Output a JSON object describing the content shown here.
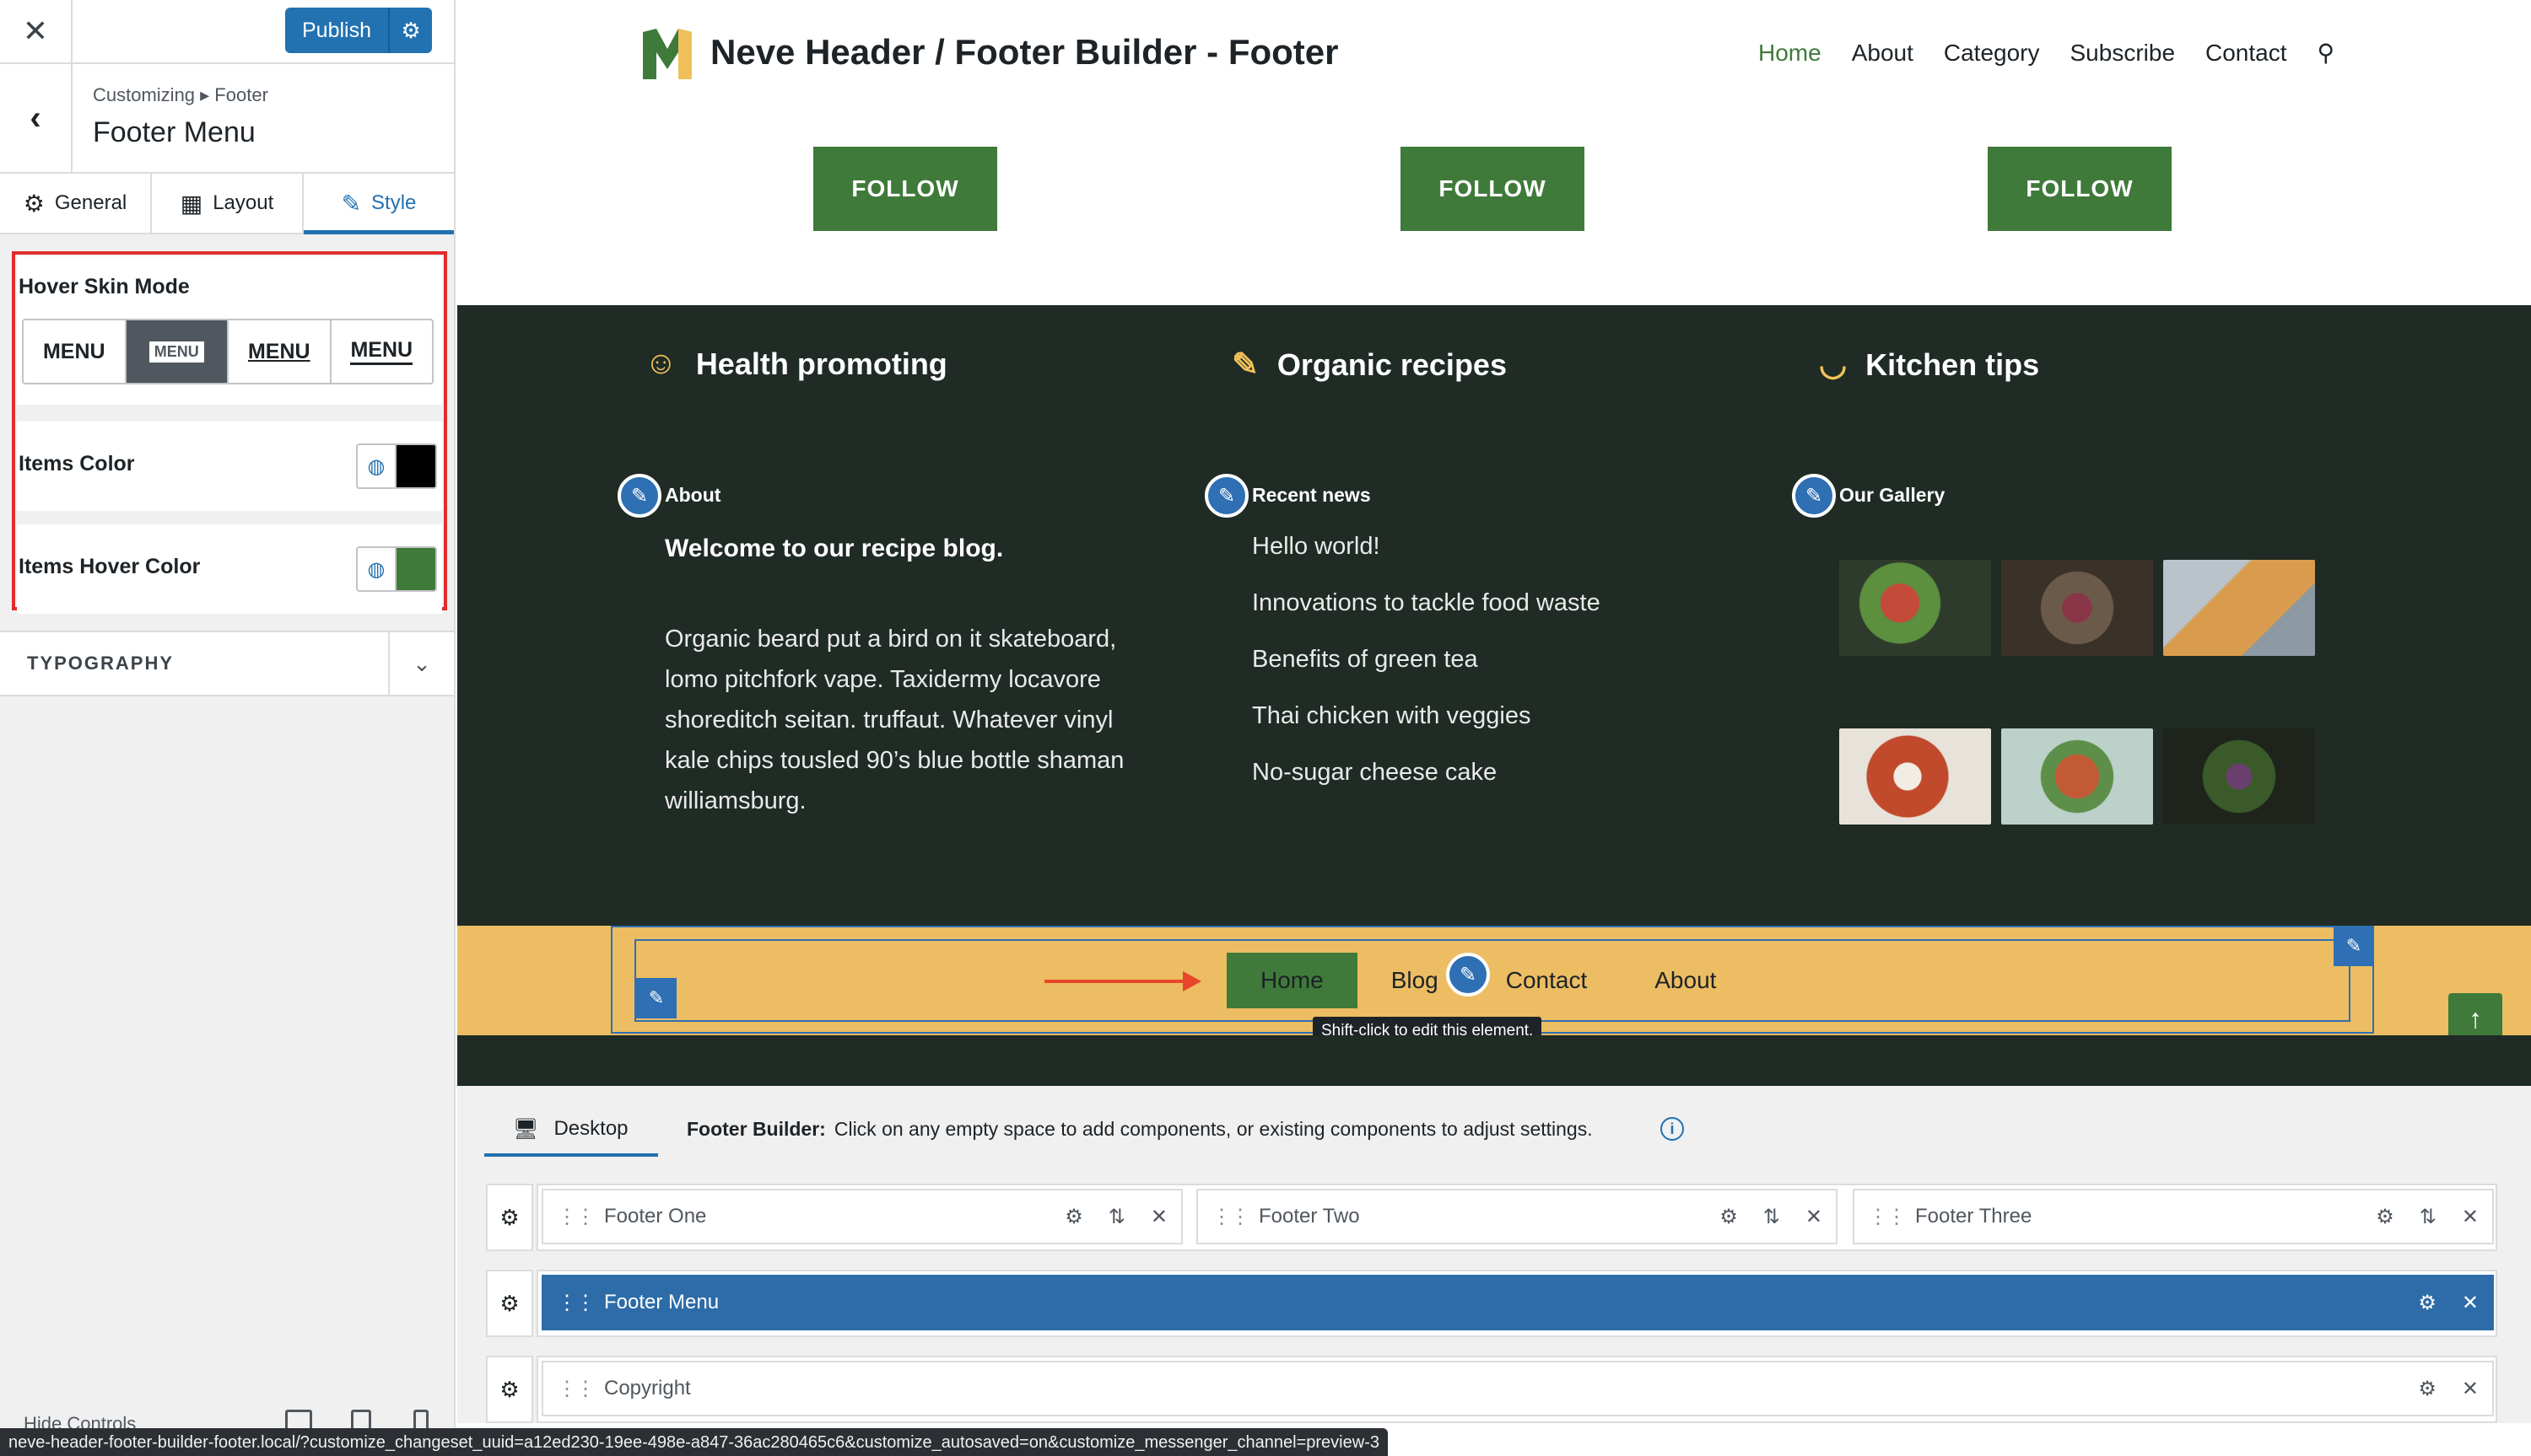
{
  "panel": {
    "publish_label": "Publish",
    "breadcrumb": "Customizing ▸ Footer",
    "section_title": "Footer Menu",
    "tabs": [
      {
        "label": "General",
        "icon": "gear-icon"
      },
      {
        "label": "Layout",
        "icon": "layout-icon"
      },
      {
        "label": "Style",
        "icon": "brush-icon"
      }
    ],
    "hover_skin_label": "Hover Skin Mode",
    "skin_options": [
      "MENU",
      "MENU",
      "MENU",
      "MENU"
    ],
    "skin_selected_index": 1,
    "items_color_label": "Items Color",
    "items_color_value": "#000000",
    "items_hover_color_label": "Items Hover Color",
    "items_hover_color_value": "#3f7a3a",
    "typography_label": "TYPOGRAPHY",
    "hide_controls": "Hide Controls"
  },
  "site": {
    "title": "Neve Header / Footer Builder - Footer",
    "nav": [
      "Home",
      "About",
      "Category",
      "Subscribe",
      "Contact"
    ],
    "nav_active": "Home",
    "follow_label": "FOLLOW",
    "features": [
      {
        "label": "Health promoting",
        "icon": "smile-icon"
      },
      {
        "label": "Organic recipes",
        "icon": "carrot-icon"
      },
      {
        "label": "Kitchen tips",
        "icon": "bowl-icon"
      }
    ],
    "widgets": {
      "about_title": "About",
      "about_lead": "Welcome to our recipe blog.",
      "about_body": "Organic beard put a bird on it skateboard, lomo pitchfork vape. Taxidermy locavore shoreditch seitan. truffaut. Whatever vinyl kale chips tousled 90’s blue bottle shaman williamsburg.",
      "news_title": "Recent news",
      "news": [
        "Hello world!",
        "Innovations to tackle food waste",
        "Benefits of green tea",
        "Thai chicken with veggies",
        "No-sugar cheese cake"
      ],
      "gallery_title": "Our Gallery"
    },
    "footer_menu": [
      "Home",
      "Blog",
      "Contact",
      "About"
    ],
    "tooltip": "Shift-click to edit this element."
  },
  "builder": {
    "device_label": "Desktop",
    "hint_bold": "Footer Builder:",
    "hint_text": "Click on any empty space to add components, or existing components to adjust settings.",
    "rows": {
      "top": [
        "Footer One",
        "Footer Two",
        "Footer Three"
      ],
      "main": "Footer Menu",
      "bottom": "Copyright"
    }
  },
  "status_url": "neve-header-footer-builder-footer.local/?customize_changeset_uuid=a12ed230-19ee-498e-a847-36ac280465c6&customize_autosaved=on&customize_messenger_channel=preview-3",
  "colors": {
    "accent_green": "#3f7a3a",
    "footer_dark": "#1f2b24",
    "menu_bar": "#ecbd62",
    "wp_blue": "#2271b1"
  }
}
